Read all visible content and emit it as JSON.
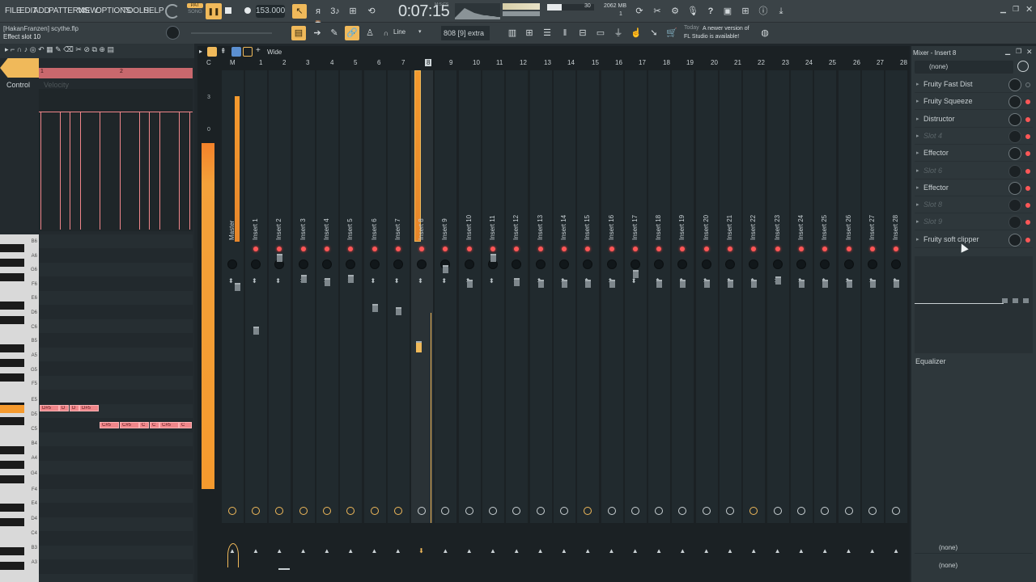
{
  "menu": [
    "FILE",
    "EDIT",
    "ADD",
    "PATTERNS",
    "VIEW",
    "OPTIONS",
    "TOOLS",
    "HELP"
  ],
  "transport": {
    "pat_label": "PAT",
    "song_label": "SONG",
    "tempo": "153.000",
    "time": "0:07:15",
    "time_unit": "M:S:CS",
    "cpu": "30",
    "memory": "2062 MB",
    "voices": "1"
  },
  "project": {
    "user_file": "[HakanFranzen] scythe.flp",
    "hint": "Effect slot 10"
  },
  "toolbar2": {
    "snap": "Line",
    "preset": "808 [9] extra",
    "news_date": "Today",
    "news_text": "A newer version of FL Studio is available!",
    "wide_label": "Wide"
  },
  "pianoroll": {
    "control_label": "Control",
    "velocity_label": "Velocity",
    "bar_1": "1",
    "bar_2": "2",
    "notes": [
      "D#5",
      "D",
      "D",
      "D#5",
      "C#5",
      "C#5",
      "C",
      "C",
      "C#5",
      "C"
    ],
    "key_labels": [
      "B6",
      "A6",
      "G6",
      "F6",
      "E6",
      "D6",
      "C6",
      "B5",
      "A5",
      "G5",
      "F5",
      "E5",
      "D5",
      "C5",
      "B4",
      "A4",
      "G4",
      "F4",
      "E4",
      "D4",
      "C4",
      "B3",
      "A3"
    ]
  },
  "mixer": {
    "top_labels": [
      "C",
      "M",
      "1",
      "2",
      "3",
      "4",
      "5",
      "6",
      "7",
      "8",
      "9",
      "10",
      "11",
      "12",
      "13",
      "14",
      "15",
      "16",
      "17",
      "18",
      "19",
      "20",
      "21",
      "22",
      "23",
      "24",
      "25",
      "26",
      "27",
      "28"
    ],
    "meter_scale": [
      "3",
      "0"
    ],
    "channels": [
      "Master",
      "Insert 1",
      "Insert 2",
      "Insert 3",
      "Insert 4",
      "Insert 5",
      "Insert 6",
      "Insert 7",
      "Insert 8",
      "Insert 9",
      "Insert 10",
      "Insert 11",
      "Insert 12",
      "Insert 13",
      "Insert 14",
      "Insert 15",
      "Insert 16",
      "Insert 17",
      "Insert 18",
      "Insert 19",
      "Insert 20",
      "Insert 21",
      "Insert 22",
      "Insert 23",
      "Insert 24",
      "Insert 25",
      "Insert 26",
      "Insert 27",
      "Insert 28"
    ]
  },
  "insert_panel": {
    "title": "Mixer - Insert 8",
    "input": "(none)",
    "slots": [
      "Fruity Fast Dist",
      "Fruity Squeeze",
      "Distructor",
      "Slot 4",
      "Effector",
      "Slot 6",
      "Effector",
      "Slot 8",
      "Slot 9",
      "Fruity soft clipper"
    ],
    "slot_empty": [
      false,
      false,
      false,
      true,
      false,
      true,
      false,
      true,
      true,
      false
    ],
    "equalizer_label": "Equalizer",
    "output": "(none)",
    "output2": "(none)"
  },
  "colors": {
    "accent": "#f0b95a",
    "note": "#f0868a",
    "led": "#ff5757",
    "meter": "#f59a2e"
  }
}
